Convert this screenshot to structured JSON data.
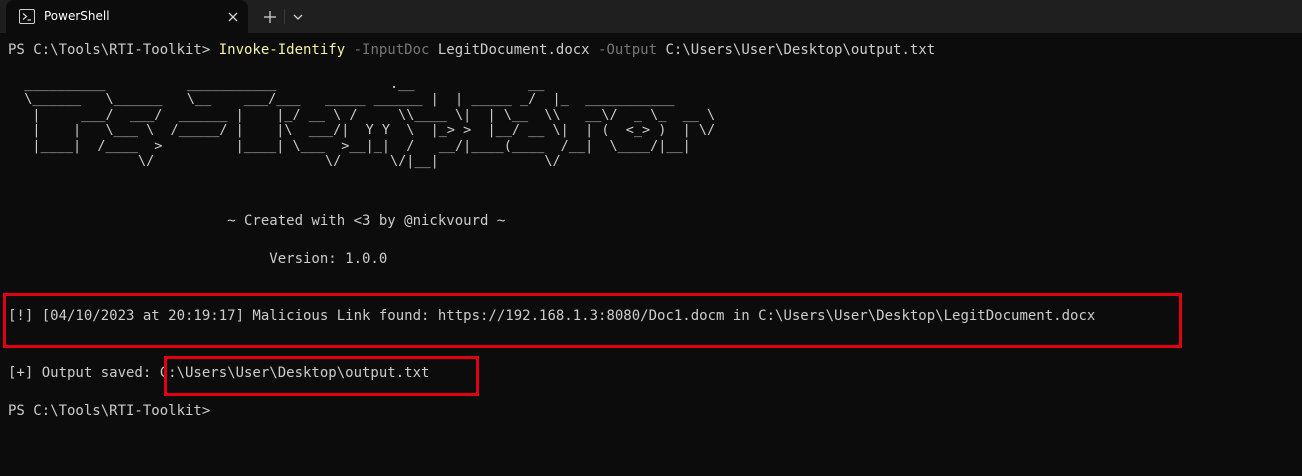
{
  "window": {
    "tab_title": "PowerShell",
    "tab_icon": "powershell-icon",
    "close_icon": "close-icon",
    "new_tab_icon": "plus-icon",
    "dropdown_icon": "chevron-down-icon"
  },
  "terminal": {
    "prompt1": "PS C:\\Tools\\RTI-Toolkit> ",
    "command": "Invoke-Identify",
    "param1": " -InputDoc",
    "arg1": " LegitDocument.docx",
    "param2": " -Output",
    "arg2": " C:\\Users\\User\\Desktop\\output.txt",
    "ascii_art": "  __________          ___________              .__              __\n  \\______   \\______   \\__    ___/___   _____ ______ |  | _____ _/  |_  ___________\n   |     ___/  ___/  ______ |    |_/ __ \\ /     \\\\____ \\|  | \\__  \\\\   __\\/  _ \\_  __ \\\n   |    |   \\___ \\  /_____/ |    |\\  ___/|  Y Y  \\  |_> >  |__/ __ \\|  | (  <_> )  | \\/\n   |____|  /____  >         |____| \\___  >__|_|  /   __/|____(____  /__|  \\____/|__|\n                \\/                     \\/      \\/|__|             \\/",
    "credit": "                          ~ Created with <3 by @nickvourd ~",
    "version": "                               Version: 1.0.0",
    "alert": "[!] [04/10/2023 at 20:19:17] Malicious Link found: https://192.168.1.3:8080/Doc1.docm in C:\\Users\\User\\Desktop\\LegitDocument.docx",
    "output_prefix": "[+] Output saved: ",
    "output_path": "C:\\Users\\User\\Desktop\\output.txt",
    "prompt2": "PS C:\\Tools\\RTI-Toolkit>"
  },
  "colors": {
    "background": "#0c0c0c",
    "tabbar": "#1f1f1f",
    "text": "#cccccc",
    "command": "#f9f1a5",
    "parameter": "#767676",
    "highlight_box": "#e0000f"
  }
}
